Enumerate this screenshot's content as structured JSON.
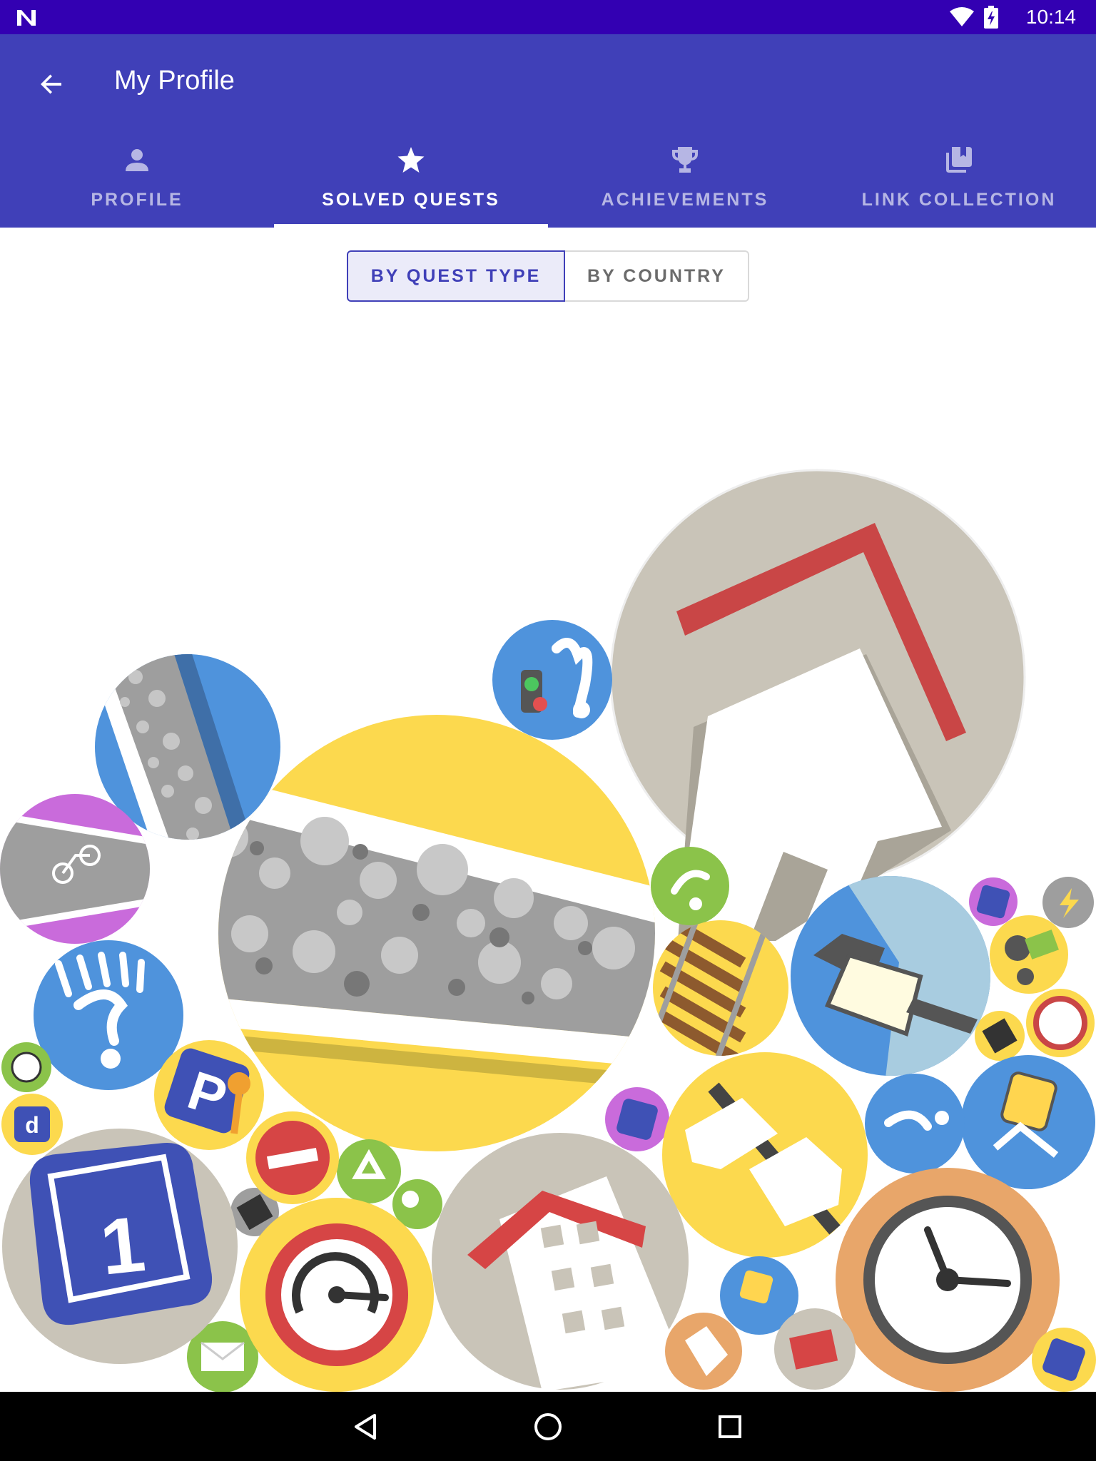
{
  "status_bar": {
    "time": "10:14"
  },
  "app_bar": {
    "title": "My Profile"
  },
  "tabs": [
    {
      "label": "PROFILE",
      "icon": "person-icon",
      "active": false
    },
    {
      "label": "SOLVED QUESTS",
      "icon": "star-icon",
      "active": true
    },
    {
      "label": "ACHIEVEMENTS",
      "icon": "trophy-icon",
      "active": false
    },
    {
      "label": "LINK COLLECTION",
      "icon": "bookmarks-icon",
      "active": false
    }
  ],
  "toggle": {
    "options": [
      "BY QUEST TYPE",
      "BY COUNTRY"
    ],
    "selected": "BY QUEST TYPE"
  },
  "quest_bubbles": [
    {
      "name": "building-type-bubble",
      "icon": "house-roof-icon",
      "color": "#c9c4b8"
    },
    {
      "name": "road-surface-bubble",
      "icon": "gravel-road-icon",
      "color": "#fcd94e"
    },
    {
      "name": "footway-surface-bubble",
      "icon": "paved-path-icon",
      "color": "#4f93dc"
    },
    {
      "name": "cycleway-bubble",
      "icon": "bicycle-lane-icon",
      "color": "#c96bdb"
    },
    {
      "name": "crossing-signals-bubble",
      "icon": "traffic-light-icon",
      "color": "#4f93dc"
    },
    {
      "name": "pedestrian-bubble",
      "icon": "pedestrian-icon",
      "color": "#4f93dc"
    },
    {
      "name": "building-levels-bubble",
      "icon": "building-levels-icon",
      "color": "#c9c4b8"
    },
    {
      "name": "housenumber-bubble",
      "icon": "house-number-icon",
      "color": "#c9c4b8"
    },
    {
      "name": "maxspeed-bubble",
      "icon": "speedometer-icon",
      "color": "#fcd94e"
    },
    {
      "name": "opening-hours-bubble",
      "icon": "clock-icon",
      "color": "#e8a66a"
    },
    {
      "name": "street-lamp-bubble",
      "icon": "street-lamp-icon",
      "color": "#4f93dc"
    },
    {
      "name": "railway-crossing-bubble",
      "icon": "railway-icon",
      "color": "#fcd94e"
    },
    {
      "name": "sign-direction-bubble",
      "icon": "signpost-icon",
      "color": "#fcd94e"
    },
    {
      "name": "bus-stop-bubble",
      "icon": "bus-stop-icon",
      "color": "#4f93dc"
    },
    {
      "name": "parking-bubble",
      "icon": "parking-key-icon",
      "color": "#fcd94e"
    },
    {
      "name": "oneway-bubble",
      "icon": "no-entry-icon",
      "color": "#fcd94e"
    }
  ]
}
